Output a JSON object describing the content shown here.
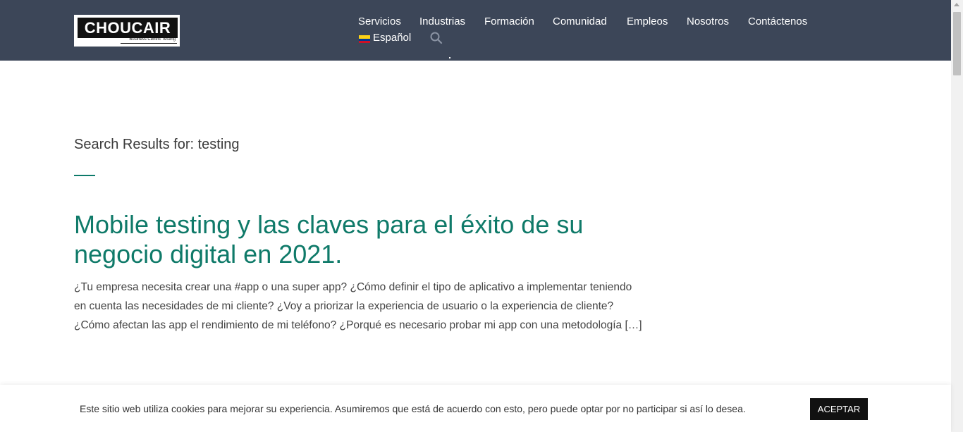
{
  "header": {
    "logo": {
      "name": "CHOUCAIR",
      "tagline": "Business Centric Testing"
    },
    "nav": [
      {
        "label": "Servicios"
      },
      {
        "label": "Industrias"
      },
      {
        "label": "Formación"
      },
      {
        "label": "Comunidad"
      },
      {
        "label": "Empleos"
      },
      {
        "label": "Nosotros"
      },
      {
        "label": "Contáctenos"
      }
    ],
    "language": {
      "label": "Español",
      "flag": "colombia-flag"
    },
    "search_icon": "search-icon",
    "background": "#3c4658"
  },
  "main": {
    "search_title": "Search Results for: testing",
    "accent_color": "#0d7a6a",
    "post": {
      "title": "Mobile testing y las claves para el éxito de su negocio digital en 2021.",
      "excerpt": "¿Tu empresa necesita crear una #app o una super app? ¿Cómo definir el tipo de aplicativo a implementar teniendo en cuenta las necesidades de mi cliente? ¿Voy a priorizar la experiencia de usuario o la experiencia de cliente?¿Cómo afectan las app el rendimiento de mi teléfono? ¿Porqué es necesario probar mi app con una metodología […]",
      "title_color": "#0f7a69"
    }
  },
  "cookie_banner": {
    "text": "Este sitio web utiliza cookies para mejorar su experiencia. Asumiremos que está de acuerdo con esto, pero puede optar por no participar si así lo desea.",
    "accept_label": "ACEPTAR"
  }
}
